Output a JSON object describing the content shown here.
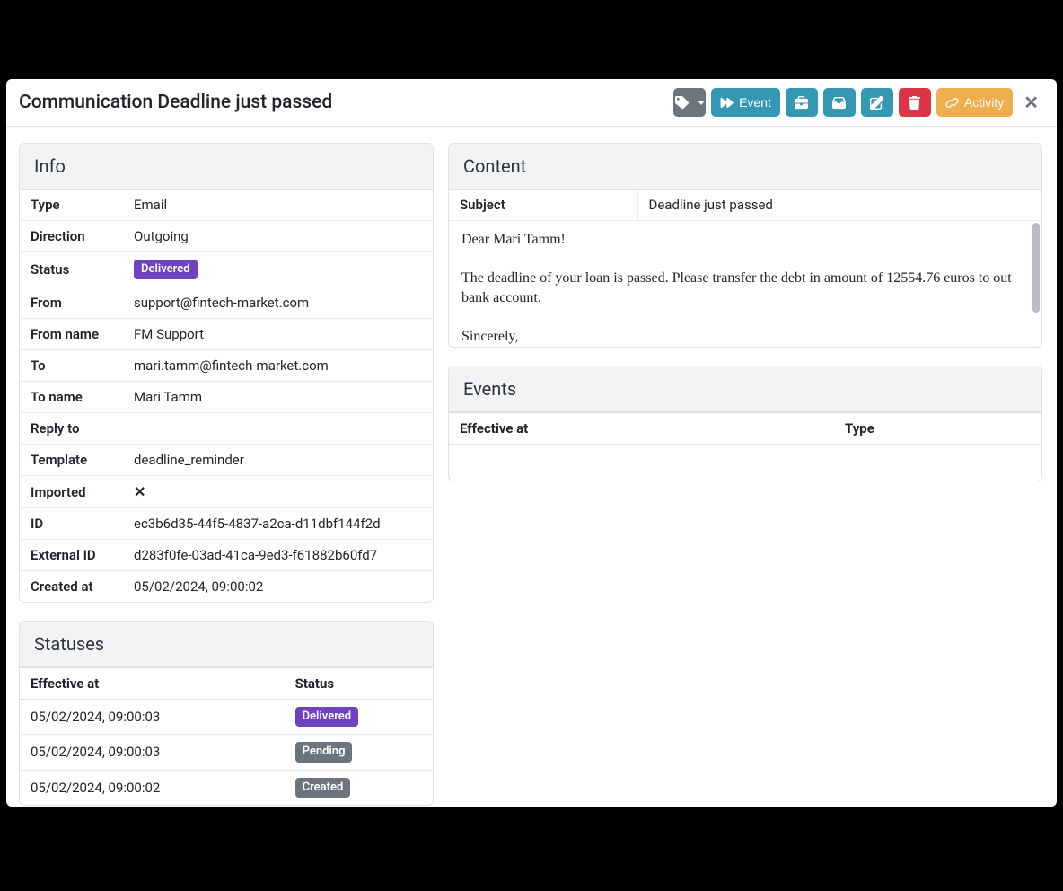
{
  "modal": {
    "title": "Communication Deadline just passed",
    "buttons": {
      "event": "Event",
      "activity": "Activity"
    }
  },
  "info": {
    "panel_title": "Info",
    "rows": {
      "type": {
        "label": "Type",
        "value": "Email"
      },
      "direction": {
        "label": "Direction",
        "value": "Outgoing"
      },
      "status": {
        "label": "Status",
        "value": "Delivered"
      },
      "from": {
        "label": "From",
        "value": "support@fintech-market.com"
      },
      "from_name": {
        "label": "From name",
        "value": "FM Support"
      },
      "to": {
        "label": "To",
        "value": "mari.tamm@fintech-market.com"
      },
      "to_name": {
        "label": "To name",
        "value": "Mari Tamm"
      },
      "reply_to": {
        "label": "Reply to",
        "value": ""
      },
      "template": {
        "label": "Template",
        "value": "deadline_reminder"
      },
      "imported": {
        "label": "Imported",
        "value": "✕"
      },
      "id": {
        "label": "ID",
        "value": "ec3b6d35-44f5-4837-a2ca-d11dbf144f2d"
      },
      "external_id": {
        "label": "External ID",
        "value": "d283f0fe-03ad-41ca-9ed3-f61882b60fd7"
      },
      "created_at": {
        "label": "Created at",
        "value": "05/02/2024, 09:00:02"
      }
    }
  },
  "statuses": {
    "panel_title": "Statuses",
    "headers": {
      "effective": "Effective at",
      "status": "Status"
    },
    "rows": [
      {
        "effective": "05/02/2024, 09:00:03",
        "status": "Delivered",
        "color": "purple"
      },
      {
        "effective": "05/02/2024, 09:00:03",
        "status": "Pending",
        "color": "gray"
      },
      {
        "effective": "05/02/2024, 09:00:02",
        "status": "Created",
        "color": "gray"
      }
    ]
  },
  "content": {
    "panel_title": "Content",
    "subject_label": "Subject",
    "subject_value": "Deadline just passed",
    "body": "Dear Mari Tamm!\n\nThe deadline of your loan is passed. Please transfer the debt in amount of 12554.76 euros to out bank account.\n\nSincerely,\nFintech Market OÜ"
  },
  "events": {
    "panel_title": "Events",
    "headers": {
      "effective": "Effective at",
      "type": "Type"
    }
  }
}
